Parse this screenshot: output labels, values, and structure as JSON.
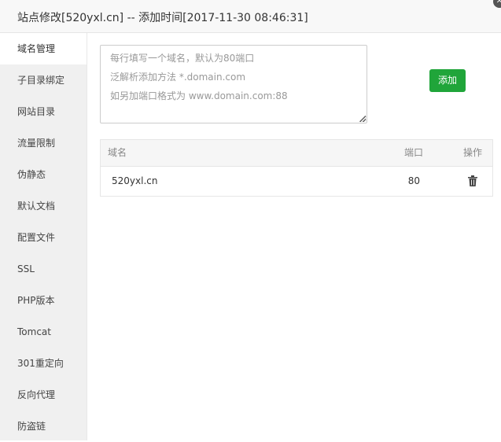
{
  "window": {
    "title": "站点修改[520yxl.cn] -- 添加时间[2017-11-30 08:46:31]"
  },
  "sidebar": {
    "items": [
      {
        "label": "域名管理"
      },
      {
        "label": "子目录绑定"
      },
      {
        "label": "网站目录"
      },
      {
        "label": "流量限制"
      },
      {
        "label": "伪静态"
      },
      {
        "label": "默认文档"
      },
      {
        "label": "配置文件"
      },
      {
        "label": "SSL"
      },
      {
        "label": "PHP版本"
      },
      {
        "label": "Tomcat"
      },
      {
        "label": "301重定向"
      },
      {
        "label": "反向代理"
      },
      {
        "label": "防盗链"
      }
    ],
    "active_index": 0
  },
  "domain_input": {
    "hints": [
      "每行填写一个域名，默认为80端口",
      "泛解析添加方法 *.domain.com",
      "如另加端口格式为 www.domain.com:88"
    ],
    "value": ""
  },
  "add_button": {
    "label": "添加"
  },
  "table": {
    "columns": {
      "name": "域名",
      "port": "端口",
      "action": "操作"
    },
    "rows": [
      {
        "name": "520yxl.cn",
        "port": "80"
      }
    ]
  },
  "colors": {
    "accent": "#20a53a",
    "sidebar_bg": "#f0f0f0",
    "header_bg": "#f8f8f8"
  },
  "icons": {
    "delete": "trash-icon",
    "close": "close-icon"
  }
}
